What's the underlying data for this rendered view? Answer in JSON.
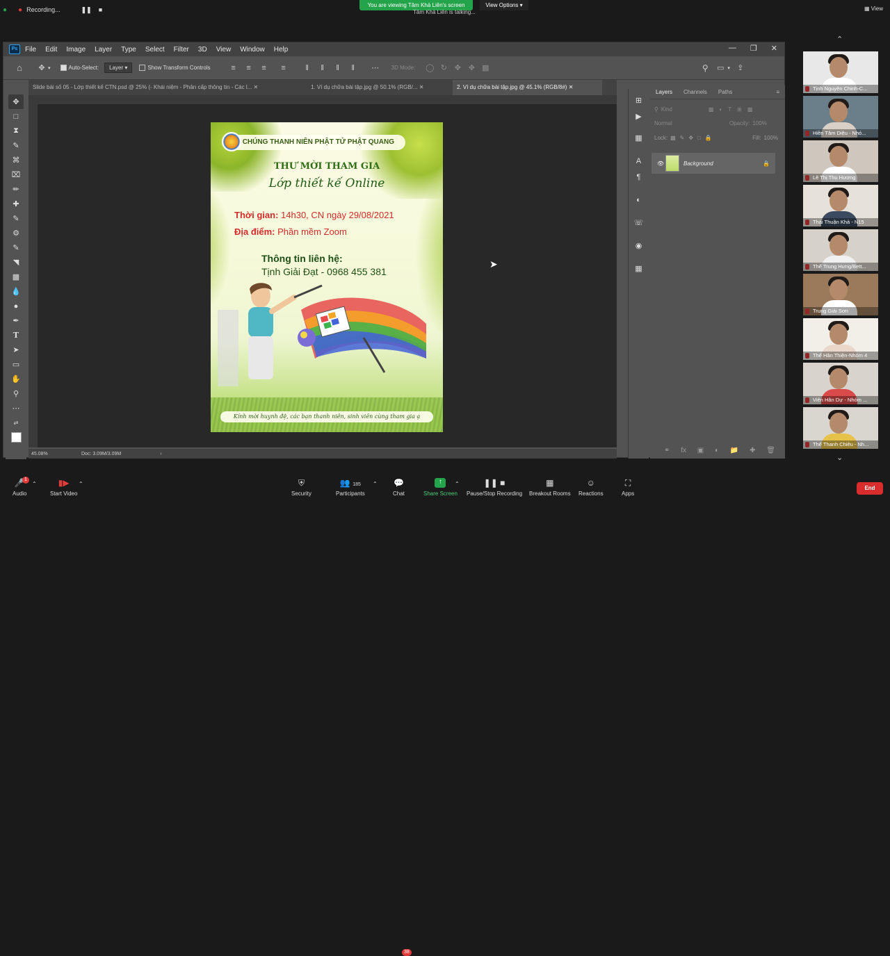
{
  "zoom": {
    "recording_label": "Recording...",
    "share_banner": "You are viewing Tâm Khả Liên's screen",
    "talking": "Tâm Khả Liên is talking...",
    "view_options": "View Options",
    "view_label": "View",
    "bottom": {
      "audio": "Audio",
      "start_video": "Start Video",
      "security": "Security",
      "participants": "Participants",
      "participants_count": "185",
      "chat": "Chat",
      "chat_badge": "38",
      "share_screen": "Share Screen",
      "pause_recording": "Pause/Stop Recording",
      "breakout_rooms": "Breakout Rooms",
      "reactions": "Reactions",
      "apps": "Apps",
      "end": "End"
    },
    "participants": [
      {
        "name": "Tịnh Nguyên Chinh-C..."
      },
      {
        "name": "Hiền Tâm Diệu - Nhó..."
      },
      {
        "name": "Lê Thị Thu Hương"
      },
      {
        "name": "Thái Thuận Khả - N15"
      },
      {
        "name": "Thể Trung Hưng/Bett..."
      },
      {
        "name": "Trung Giải Sơn"
      },
      {
        "name": "Thể Hân Thiện-Nhóm 4"
      },
      {
        "name": "Viên Hân Dự - Nhóm ..."
      },
      {
        "name": "Thể Thanh Chiêu - Nh..."
      }
    ]
  },
  "ps": {
    "menu": [
      "File",
      "Edit",
      "Image",
      "Layer",
      "Type",
      "Select",
      "Filter",
      "3D",
      "View",
      "Window",
      "Help"
    ],
    "options": {
      "auto_select": "Auto-Select:",
      "layer_dd": "Layer",
      "show_transform": "Show Transform Controls",
      "mode_3d": "3D Mode:"
    },
    "tabs": [
      {
        "label": "Slide bài số 05 - Lớp thiết kế CTN.psd @ 25% (- Khái niệm - Phân cấp thông tin - Các l..."
      },
      {
        "label": "1. Ví dụ chữa bài tập.jpg @ 50.1% (RGB/..."
      },
      {
        "label": "2. Ví dụ chữa bài tập.jpg @ 45.1% (RGB/8#)"
      }
    ],
    "status_zoom": "45.08%",
    "status_doc": "Doc: 3.09M/3.09M",
    "layers_panel": {
      "tabs": [
        "Layers",
        "Channels",
        "Paths"
      ],
      "kind": "Kind",
      "blend": "Normal",
      "opacity_label": "Opacity:",
      "opacity": "100%",
      "lock_label": "Lock:",
      "fill_label": "Fill:",
      "fill": "100%",
      "layer_name": "Background"
    }
  },
  "poster": {
    "org": "CHÚNG THANH NIÊN PHẬT TỬ PHẬT QUANG",
    "invite": "THƯ MỜI THAM GIA",
    "class_name": "Lớp thiết kế Online",
    "time_label": "Thời gian:",
    "time_value": "14h30, CN ngày 29/08/2021",
    "place_label": "Địa điểm:",
    "place_value": "Phần mềm Zoom",
    "contact_label": "Thông tin liên hệ:",
    "contact_value": "Tịnh Giải Đạt - 0968 455 381",
    "footer": "Kính mời huynh đệ, các bạn thanh niên, sinh viên cùng tham gia ạ"
  }
}
